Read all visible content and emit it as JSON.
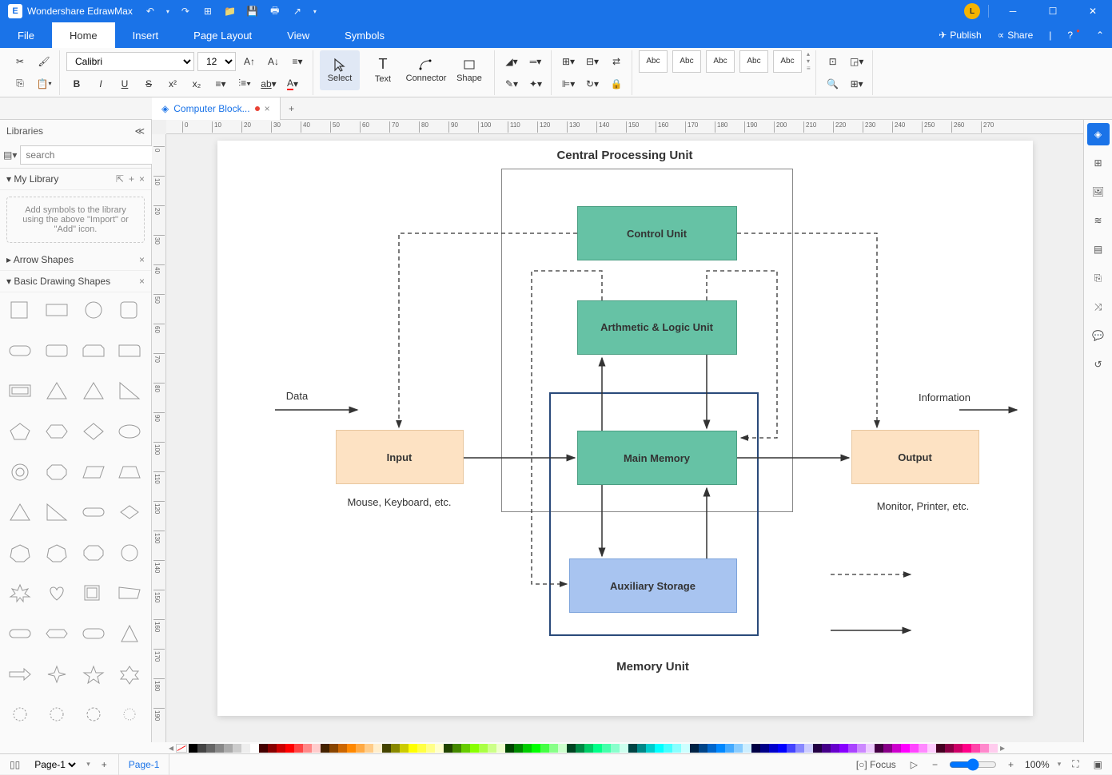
{
  "titlebar": {
    "app_name": "Wondershare EdrawMax",
    "avatar_initial": "L"
  },
  "menu": {
    "tabs": [
      "File",
      "Home",
      "Insert",
      "Page Layout",
      "View",
      "Symbols"
    ],
    "active": "Home",
    "publish": "Publish",
    "share": "Share"
  },
  "ribbon": {
    "font": "Calibri",
    "size": "12",
    "tools": {
      "select": "Select",
      "text": "Text",
      "connector": "Connector",
      "shape": "Shape"
    },
    "style_label": "Abc"
  },
  "doctab": {
    "name": "Computer Block..."
  },
  "sidebar": {
    "title": "Libraries",
    "search_placeholder": "search",
    "mylib": "My Library",
    "hint": "Add symbols to the library using the above \"Import\" or \"Add\" icon.",
    "arrow_shapes": "Arrow Shapes",
    "basic_shapes": "Basic Drawing Shapes"
  },
  "diagram": {
    "title_top": "Central Processing Unit",
    "title_bottom": "Memory Unit",
    "control": "Control Unit",
    "alu": "Arthmetic & Logic Unit",
    "memory": "Main Memory",
    "aux": "Auxiliary Storage",
    "input": "Input",
    "output": "Output",
    "data": "Data",
    "info": "Information",
    "input_sub": "Mouse, Keyboard, etc.",
    "output_sub": "Monitor, Printer, etc."
  },
  "status": {
    "page_sel": "Page-1",
    "page_tab": "Page-1",
    "focus": "Focus",
    "zoom": "100%"
  }
}
